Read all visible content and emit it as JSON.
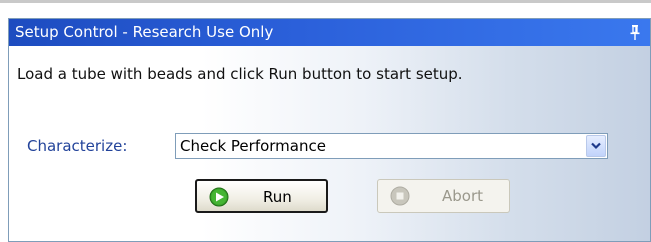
{
  "title_bar": {
    "title": "Setup Control - Research Use Only",
    "pin_icon": "pin-icon"
  },
  "instruction": "Load a tube with beads and click Run button to start setup.",
  "characterize": {
    "label": "Characterize:",
    "selected": "Check Performance",
    "arrow_icon": "chevron-down-icon"
  },
  "buttons": {
    "run": {
      "label": "Run",
      "icon": "play-icon",
      "enabled": true
    },
    "abort": {
      "label": "Abort",
      "icon": "stop-icon",
      "enabled": false
    }
  },
  "colors": {
    "title_bar": "#2b60da",
    "label_blue": "#22439a",
    "run_icon": "#3aa32c",
    "disabled_text": "#9a988c"
  }
}
